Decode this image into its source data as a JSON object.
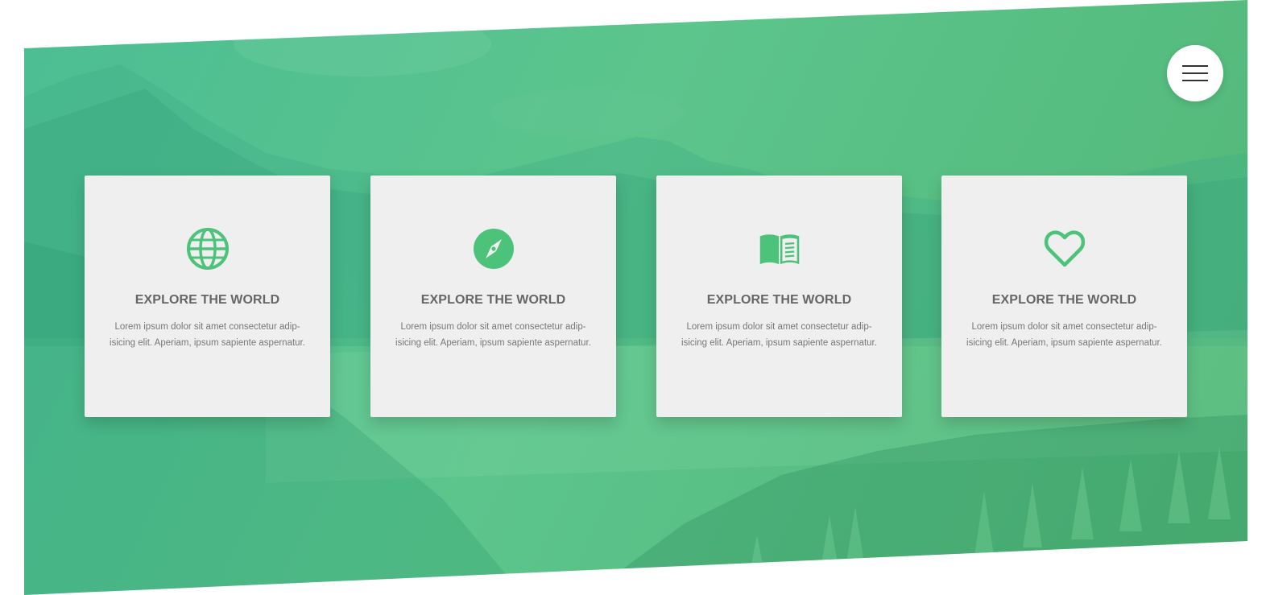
{
  "colors": {
    "accent": "#4dc27a",
    "card_background": "#efefef",
    "title_text": "#666666",
    "body_text": "#777777"
  },
  "menu": {
    "icon": "hamburger-menu-icon"
  },
  "features": [
    {
      "icon": "globe-icon",
      "title": "EXPLORE THE WORLD",
      "text": "Lorem ipsum dolor sit amet consectetur adip-isicing elit. Aperiam, ipsum sapiente aspernatur."
    },
    {
      "icon": "compass-icon",
      "title": "EXPLORE THE WORLD",
      "text": "Lorem ipsum dolor sit amet consectetur adip-isicing elit. Aperiam, ipsum sapiente aspernatur."
    },
    {
      "icon": "book-icon",
      "title": "EXPLORE THE WORLD",
      "text": "Lorem ipsum dolor sit amet consectetur adip-isicing elit. Aperiam, ipsum sapiente aspernatur."
    },
    {
      "icon": "heart-icon",
      "title": "EXPLORE THE WORLD",
      "text": "Lorem ipsum dolor sit amet consectetur adip-isicing elit. Aperiam, ipsum sapiente aspernatur."
    }
  ]
}
